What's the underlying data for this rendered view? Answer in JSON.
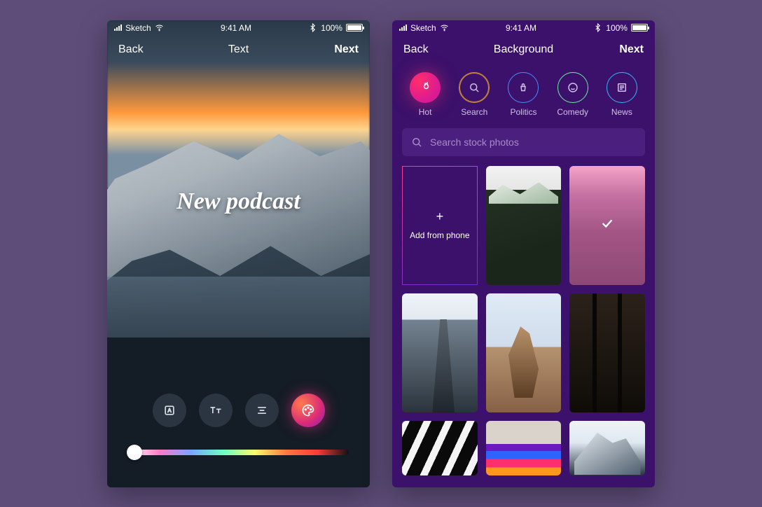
{
  "status": {
    "carrier": "Sketch",
    "time": "9:41 AM",
    "battery": "100%"
  },
  "screenA": {
    "nav": {
      "back": "Back",
      "title": "Text",
      "next": "Next"
    },
    "heading": "New podcast",
    "tools": {
      "font": {
        "name": "font-button",
        "active": false
      },
      "size": {
        "name": "size-button",
        "active": false
      },
      "align": {
        "name": "align-button",
        "active": false
      },
      "color": {
        "name": "color-button",
        "active": true
      }
    },
    "slider_value": 0
  },
  "screenB": {
    "nav": {
      "back": "Back",
      "title": "Background",
      "next": "Next"
    },
    "categories": [
      {
        "id": "hot",
        "label": "Hot",
        "active": true
      },
      {
        "id": "search",
        "label": "Search",
        "active": false
      },
      {
        "id": "politics",
        "label": "Politics",
        "active": false
      },
      {
        "id": "comedy",
        "label": "Comedy",
        "active": false
      },
      {
        "id": "news",
        "label": "News",
        "active": false
      }
    ],
    "search_placeholder": "Search stock photos",
    "add_tile": {
      "plus": "+",
      "label": "Add from phone"
    },
    "tiles": [
      {
        "id": "forest",
        "selected": false
      },
      {
        "id": "sunset",
        "selected": true
      },
      {
        "id": "road",
        "selected": false
      },
      {
        "id": "rock",
        "selected": false
      },
      {
        "id": "dark",
        "selected": false
      },
      {
        "id": "bw",
        "selected": false
      },
      {
        "id": "glitch",
        "selected": false
      },
      {
        "id": "peak",
        "selected": false
      }
    ]
  }
}
